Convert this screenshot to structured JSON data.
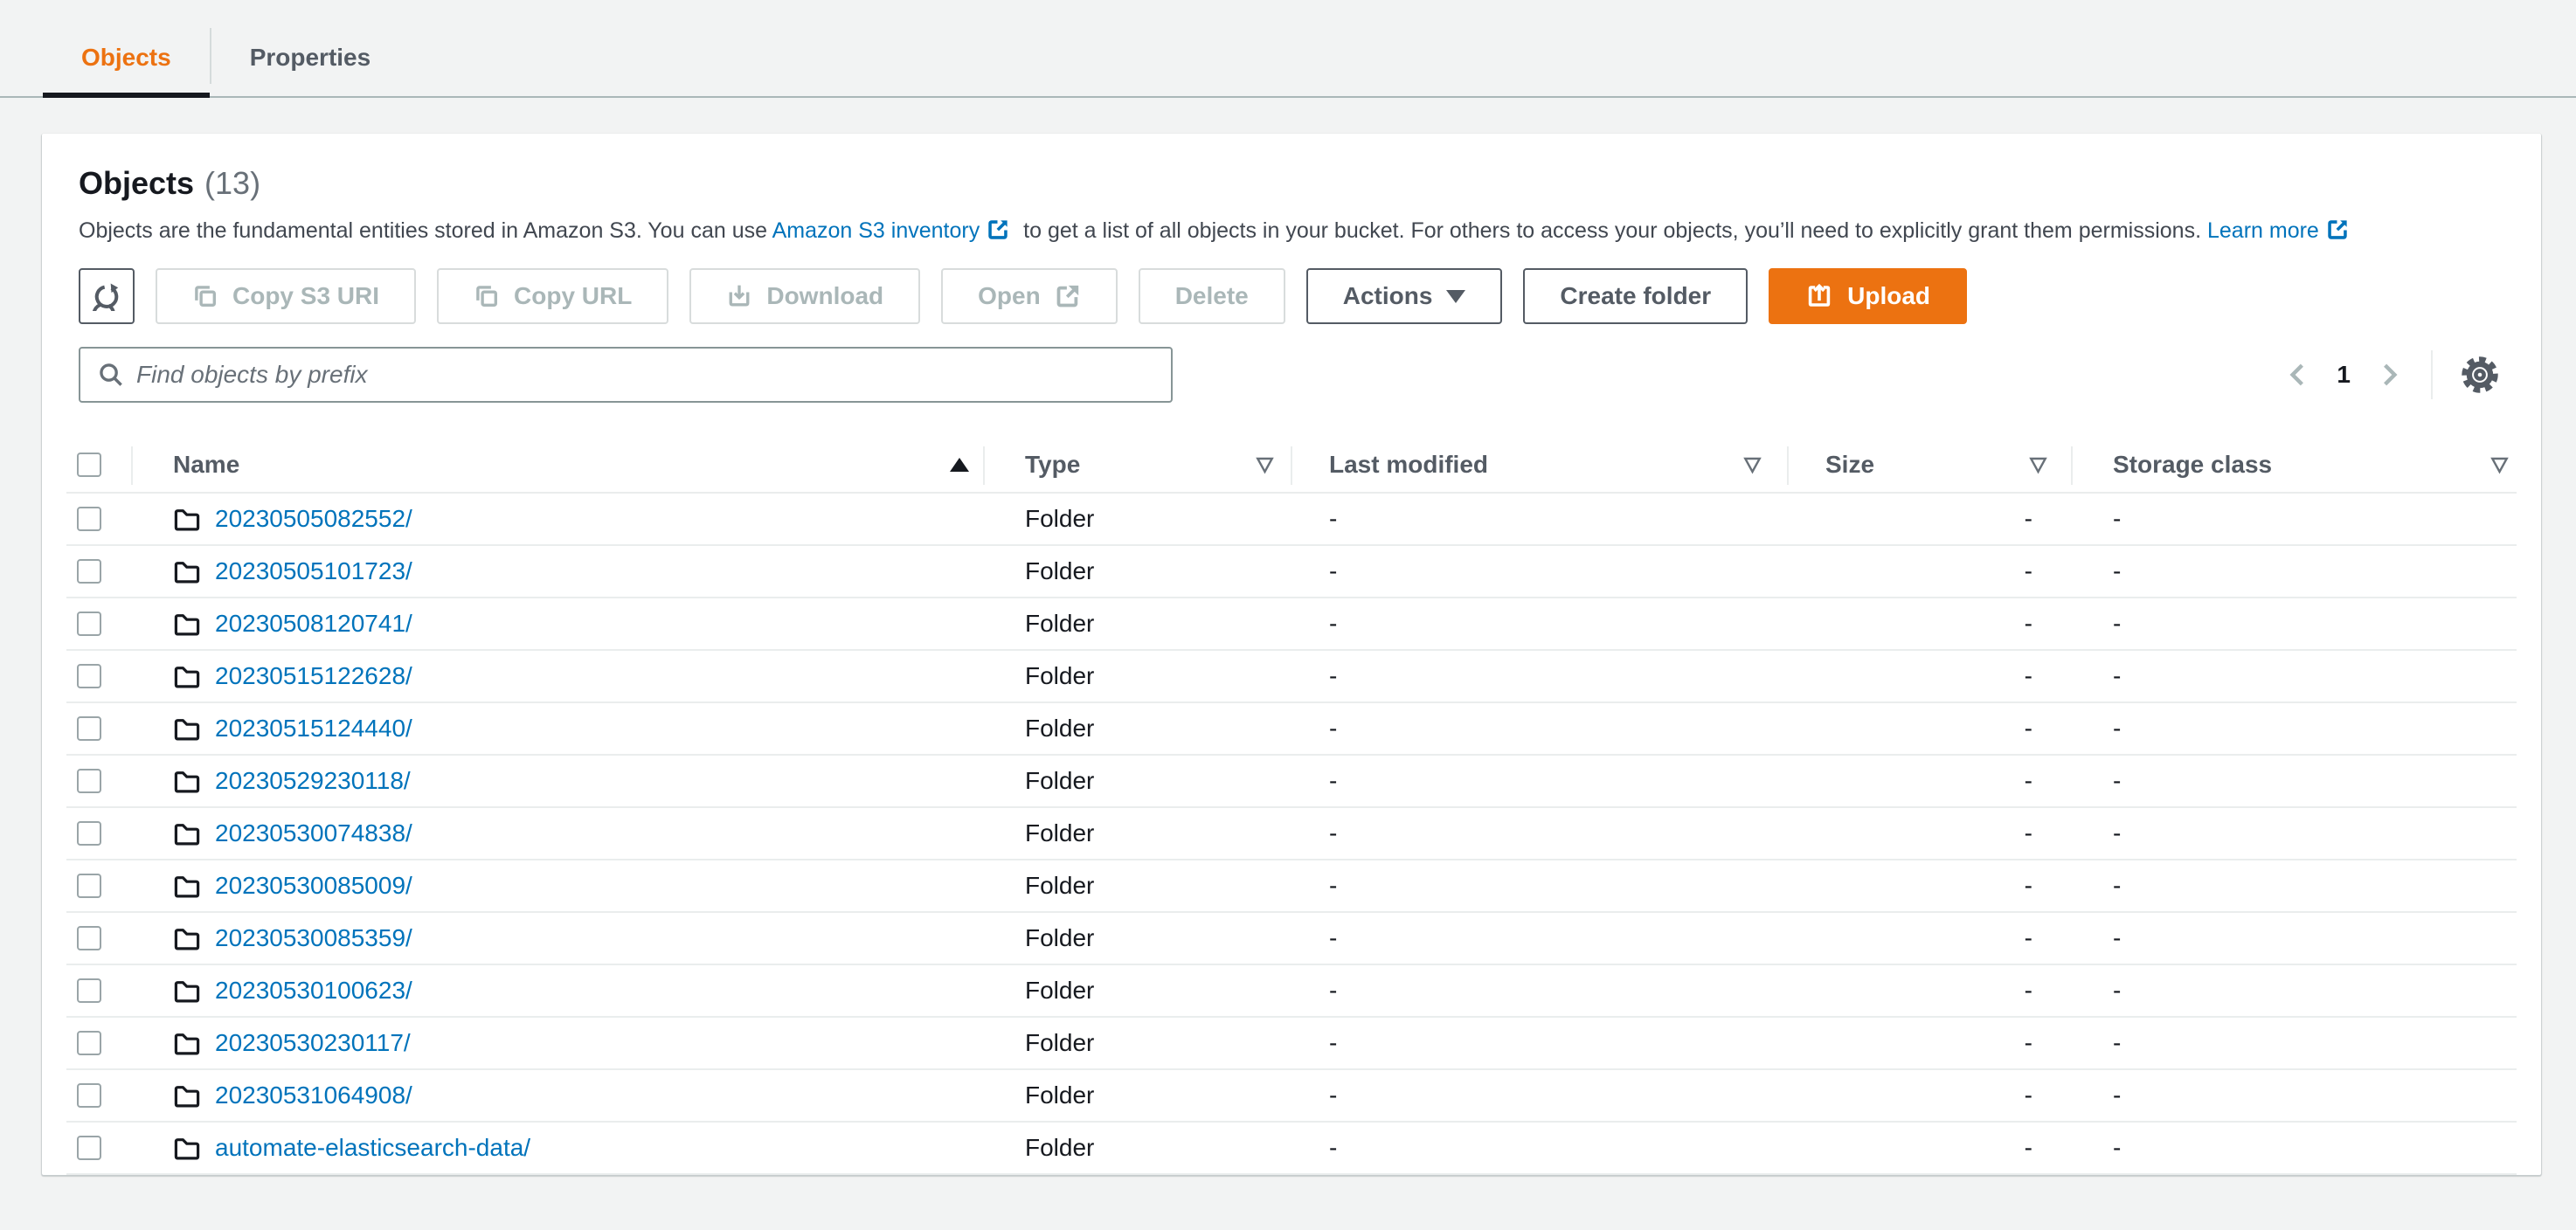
{
  "tabs": {
    "objects": "Objects",
    "properties": "Properties"
  },
  "header": {
    "title": "Objects",
    "count": "(13)"
  },
  "description": {
    "text_1": "Objects are the fundamental entities stored in Amazon S3. You can use",
    "inventory_link": "Amazon S3 inventory",
    "text_2": "to get a list of all objects in your bucket. For others to access your objects, you’ll need to explicitly grant them permissions.",
    "learn_more_link": "Learn more"
  },
  "toolbar": {
    "copy_s3_uri": "Copy S3 URI",
    "copy_url": "Copy URL",
    "download": "Download",
    "open": "Open",
    "delete": "Delete",
    "actions": "Actions",
    "create_folder": "Create folder",
    "upload": "Upload"
  },
  "filter": {
    "search_placeholder": "Find objects by prefix"
  },
  "pagination": {
    "current_page": "1"
  },
  "table": {
    "headers": {
      "name": "Name",
      "type": "Type",
      "last_modified": "Last modified",
      "size": "Size",
      "storage_class": "Storage class"
    },
    "rows": [
      {
        "name": "20230505082552/",
        "type": "Folder",
        "last_modified": "-",
        "size": "-",
        "storage_class": "-"
      },
      {
        "name": "20230505101723/",
        "type": "Folder",
        "last_modified": "-",
        "size": "-",
        "storage_class": "-"
      },
      {
        "name": "20230508120741/",
        "type": "Folder",
        "last_modified": "-",
        "size": "-",
        "storage_class": "-"
      },
      {
        "name": "20230515122628/",
        "type": "Folder",
        "last_modified": "-",
        "size": "-",
        "storage_class": "-"
      },
      {
        "name": "20230515124440/",
        "type": "Folder",
        "last_modified": "-",
        "size": "-",
        "storage_class": "-"
      },
      {
        "name": "20230529230118/",
        "type": "Folder",
        "last_modified": "-",
        "size": "-",
        "storage_class": "-"
      },
      {
        "name": "20230530074838/",
        "type": "Folder",
        "last_modified": "-",
        "size": "-",
        "storage_class": "-"
      },
      {
        "name": "20230530085009/",
        "type": "Folder",
        "last_modified": "-",
        "size": "-",
        "storage_class": "-"
      },
      {
        "name": "20230530085359/",
        "type": "Folder",
        "last_modified": "-",
        "size": "-",
        "storage_class": "-"
      },
      {
        "name": "20230530100623/",
        "type": "Folder",
        "last_modified": "-",
        "size": "-",
        "storage_class": "-"
      },
      {
        "name": "20230530230117/",
        "type": "Folder",
        "last_modified": "-",
        "size": "-",
        "storage_class": "-"
      },
      {
        "name": "20230531064908/",
        "type": "Folder",
        "last_modified": "-",
        "size": "-",
        "storage_class": "-"
      },
      {
        "name": "automate-elasticsearch-data/",
        "type": "Folder",
        "last_modified": "-",
        "size": "-",
        "storage_class": "-"
      }
    ]
  },
  "colors": {
    "accent_orange": "#ec7211",
    "link_blue": "#0073bb",
    "dark_text": "#16191f",
    "muted_text": "#545b64"
  }
}
